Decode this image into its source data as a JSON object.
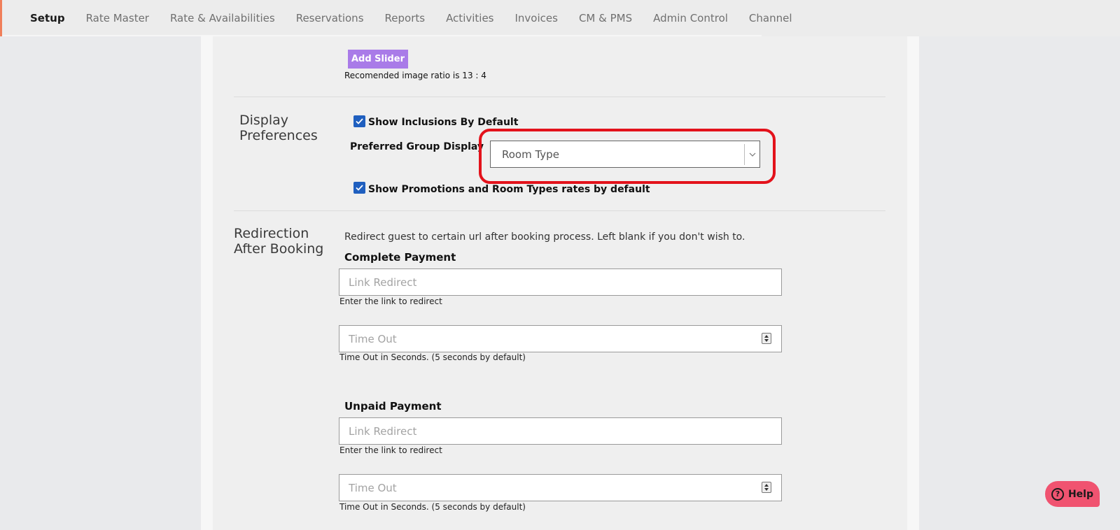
{
  "nav": {
    "items": [
      {
        "label": "Setup",
        "active": true
      },
      {
        "label": "Rate Master"
      },
      {
        "label": "Rate & Availabilities"
      },
      {
        "label": "Reservations"
      },
      {
        "label": "Reports"
      },
      {
        "label": "Activities"
      },
      {
        "label": "Invoices"
      },
      {
        "label": "CM & PMS"
      },
      {
        "label": "Admin Control"
      },
      {
        "label": "Channel"
      }
    ],
    "accent_color": "#f07f5a"
  },
  "slider": {
    "button_label": "Add Slider",
    "ratio_note": "Recomended image ratio is 13 : 4",
    "button_color": "#a97be8"
  },
  "display_preferences": {
    "title_line1": "Display",
    "title_line2": "Preferences",
    "show_inclusions_label": "Show Inclusions By Default",
    "show_inclusions_checked": true,
    "preferred_group_label": "Preferred Group Display",
    "preferred_group_value": "Room Type",
    "show_promotions_label": "Show Promotions and Room Types rates by default",
    "show_promotions_checked": true,
    "highlight_color": "#e3121b"
  },
  "redirection": {
    "title_line1": "Redirection",
    "title_line2": "After Booking",
    "description": "Redirect guest to certain url after booking process. Left blank if you don't wish to.",
    "complete_payment": {
      "title": "Complete Payment",
      "link_placeholder": "Link Redirect",
      "link_note": "Enter the link to redirect",
      "timeout_placeholder": "Time Out",
      "timeout_note": "Time Out in Seconds. (5 seconds by default)"
    },
    "unpaid_payment": {
      "title": "Unpaid Payment",
      "link_placeholder": "Link Redirect",
      "link_note": "Enter the link to redirect",
      "timeout_placeholder": "Time Out",
      "timeout_note": "Time Out in Seconds. (5 seconds by default)"
    }
  },
  "help": {
    "label": "Help",
    "icon": "question-circle-icon",
    "color": "#f05370"
  }
}
